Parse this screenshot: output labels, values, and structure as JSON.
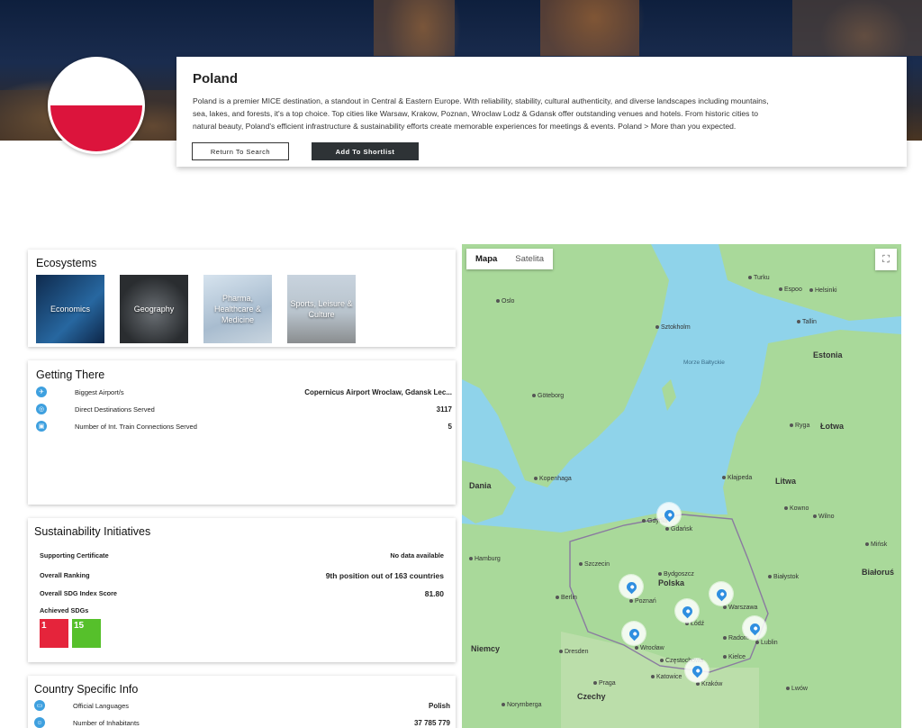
{
  "country": {
    "name": "Poland",
    "description": "Poland is a premier MICE destination, a standout in Central & Eastern Europe. With reliability, stability, cultural authenticity, and diverse landscapes including mountains, sea, lakes, and forests, it's a top choice. Top cities like Warsaw, Krakow, Poznan, Wroclaw Lodz & Gdansk offer outstanding venues and hotels. From historic cities to natural beauty, Poland's efficient infrastructure & sustainability efforts create memorable experiences for meetings & events. Poland > More than you expected.",
    "buttons": {
      "return": "Return To Search",
      "shortlist": "Add To Shortlist"
    }
  },
  "ecosystems": {
    "title": "Ecosystems",
    "tiles": [
      "Economics",
      "Geography",
      "Pharma, Healthcare & Medicine",
      "Sports, Leisure & Culture"
    ]
  },
  "getting_there": {
    "title": "Getting There",
    "rows": [
      {
        "icon": "plane-icon",
        "label": "Biggest Airport/s",
        "value": "Copernicus Airport Wroclaw, Gdansk Lec..."
      },
      {
        "icon": "destinations-icon",
        "label": "Direct Destinations Served",
        "value": "3117"
      },
      {
        "icon": "train-icon",
        "label": "Number of Int. Train Connections Served",
        "value": "5"
      }
    ]
  },
  "sustainability": {
    "title": "Sustainability Initiatives",
    "rows": [
      {
        "label": "Supporting Certificate",
        "value": "No data available"
      },
      {
        "label": "Overall Ranking",
        "value": "9th position out of 163 countries"
      },
      {
        "label": "Overall SDG Index Score",
        "value": "81.80"
      },
      {
        "label": "Achieved SDGs",
        "value": ""
      }
    ],
    "sdgs": [
      "1",
      "15"
    ]
  },
  "country_info": {
    "title": "Country Specific Info",
    "rows": [
      {
        "icon": "language-icon",
        "label": "Official Languages",
        "value": "Polish"
      },
      {
        "icon": "people-icon",
        "label": "Number of Inhabitants",
        "value": "37 785 779"
      }
    ]
  },
  "map": {
    "tabs": [
      "Mapa",
      "Satelita"
    ],
    "countries": [
      "Estonia",
      "Łotwa",
      "Litwa",
      "Dania",
      "Polska",
      "Niemcy",
      "Czechy",
      "Białoruś"
    ],
    "cities": [
      "Oslo",
      "Turku",
      "Espoo",
      "Helsinki",
      "Tallin",
      "Sztokholm",
      "Göteborg",
      "Ryga",
      "Kopenhaga",
      "Kłajpeda",
      "Kowno",
      "Wilno",
      "Gdańsk",
      "Gdynia",
      "Szczecin",
      "Bydgoszcz",
      "Poznań",
      "Łódź",
      "Warszawa",
      "Lublin",
      "Wrocław",
      "Kraków",
      "Berlin",
      "Hamburg",
      "Praga",
      "Katowice",
      "Częstochowa",
      "Mińsk",
      "Białystok",
      "Radom",
      "Dresden",
      "Norymberga",
      "Lwów",
      "Kielce"
    ],
    "sea_label": "Morze Bałtyckie",
    "fullscreen": "⛶"
  }
}
